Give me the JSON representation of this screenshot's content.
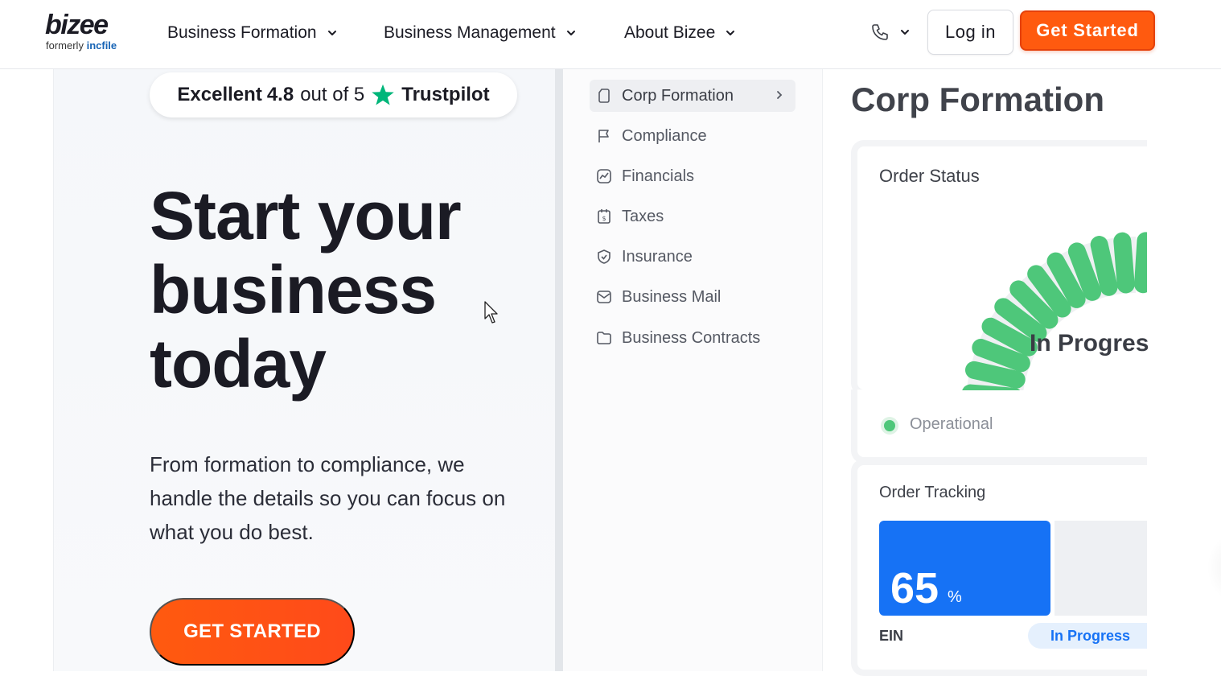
{
  "header": {
    "logo_word": "bizee",
    "logo_formerly": "formerly",
    "logo_brand": "incfile",
    "nav": [
      {
        "label": "Business Formation"
      },
      {
        "label": "Business Management"
      },
      {
        "label": "About Bizee"
      }
    ],
    "phone_icon": "phone-icon",
    "login_label": "Log in",
    "get_started_label": "Get Started"
  },
  "hero": {
    "trustpilot": {
      "prefix": "Excellent",
      "rating": "4.8",
      "middle": "out of 5",
      "brand": "Trustpilot",
      "star_color": "#00b67a"
    },
    "title_line1": "Start your",
    "title_line2": "business",
    "title_line3": "today",
    "subtitle": "From formation to compliance, we handle the details so you can focus on what you do best.",
    "cta_label": "GET STARTED"
  },
  "dashboard": {
    "sidebar": [
      {
        "label": "Corp Formation",
        "icon": "document-icon",
        "active": true
      },
      {
        "label": "Compliance",
        "icon": "flag-icon"
      },
      {
        "label": "Financials",
        "icon": "chart-icon"
      },
      {
        "label": "Taxes",
        "icon": "receipt-icon"
      },
      {
        "label": "Insurance",
        "icon": "shield-check-icon"
      },
      {
        "label": "Business Mail",
        "icon": "mail-icon"
      },
      {
        "label": "Business Contracts",
        "icon": "folder-icon"
      }
    ],
    "title": "Corp Formation",
    "order_status": {
      "title": "Order Status",
      "gauge_text": "In Progres",
      "status": "Operational"
    },
    "order_tracking": {
      "title": "Order Tracking",
      "progress": 65,
      "progress_value": "65",
      "progress_unit": "%",
      "item": "EIN",
      "item_status": "In Progress"
    }
  },
  "colors": {
    "accent": "#ff5a0f",
    "brand_blue": "#1764b5",
    "progress_blue": "#1672f5",
    "gauge_green": "#4ec77a"
  }
}
